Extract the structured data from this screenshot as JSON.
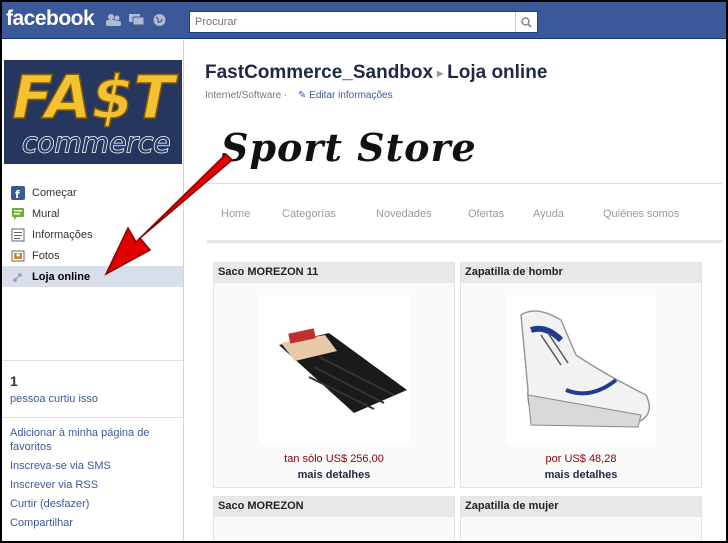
{
  "topbar": {
    "logo": "facebook",
    "search_placeholder": "Procurar",
    "icons": [
      "friends-icon",
      "messages-icon",
      "globe-icon"
    ]
  },
  "leftcol": {
    "brand_logo_text_1": "FA$T",
    "brand_logo_text_2": "commerce",
    "nav": [
      {
        "label": "Começar",
        "icon": "facebook-icon"
      },
      {
        "label": "Mural",
        "icon": "wall-icon"
      },
      {
        "label": "Informações",
        "icon": "info-icon"
      },
      {
        "label": "Fotos",
        "icon": "photos-icon"
      },
      {
        "label": "Loja online",
        "icon": "store-icon",
        "active": true
      }
    ],
    "likes": {
      "count": "1",
      "text": "pessoa curtiu isso"
    },
    "actions": [
      "Adicionar à minha página de favoritos",
      "Inscreva-se via SMS",
      "Inscrever via RSS",
      "Curtir (desfazer)",
      "Compartilhar"
    ]
  },
  "main": {
    "page_name": "FastCommerce_Sandbox",
    "section": "Loja online",
    "category": "Internet/Software ·",
    "edit_label": "Editar informações",
    "store": {
      "title": "Sport Store",
      "menu": [
        "Home",
        "Categorías",
        "Novedades",
        "Ofertas",
        "Ayuda",
        "Quiénes somos"
      ],
      "products": [
        {
          "name": "Saco MOREZON 11",
          "price_prefix": "tan sólo",
          "price": "US$ 256,00",
          "link": "mais detalhes"
        },
        {
          "name": "Zapatilla de hombr",
          "price_prefix": "por",
          "price": "US$ 48,28",
          "link": "mais detalhes"
        },
        {
          "name": "Saco MOREZON",
          "price_prefix": "",
          "price": "",
          "link": ""
        },
        {
          "name": "Zapatilla de mujer",
          "price_prefix": "",
          "price": "",
          "link": ""
        }
      ]
    }
  },
  "colors": {
    "topbar": "#3b5998",
    "active_nav": "#d8dfea",
    "link": "#3b5998",
    "price": "#8b0000",
    "arrow": "#e00000"
  }
}
